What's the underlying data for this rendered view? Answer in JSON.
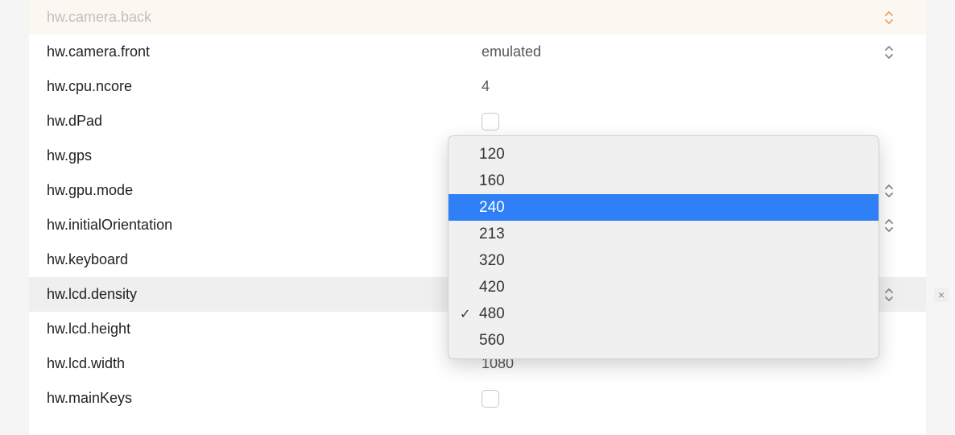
{
  "rows": [
    {
      "key": "hw.camera.back",
      "value": "",
      "type": "select",
      "faded": true,
      "stepperColor": "orange"
    },
    {
      "key": "hw.camera.front",
      "value": "emulated",
      "type": "select"
    },
    {
      "key": "hw.cpu.ncore",
      "value": "4",
      "type": "text"
    },
    {
      "key": "hw.dPad",
      "value": "",
      "type": "checkbox"
    },
    {
      "key": "hw.gps",
      "value": "",
      "type": "none"
    },
    {
      "key": "hw.gpu.mode",
      "value": "",
      "type": "select"
    },
    {
      "key": "hw.initialOrientation",
      "value": "",
      "type": "select"
    },
    {
      "key": "hw.keyboard",
      "value": "",
      "type": "none"
    },
    {
      "key": "hw.lcd.density",
      "value": "",
      "type": "select",
      "selected": true,
      "showClose": true
    },
    {
      "key": "hw.lcd.height",
      "value": "",
      "type": "none"
    },
    {
      "key": "hw.lcd.width",
      "value": "1080",
      "type": "text"
    },
    {
      "key": "hw.mainKeys",
      "value": "",
      "type": "checkbox"
    }
  ],
  "dropdown": {
    "options": [
      "120",
      "160",
      "240",
      "213",
      "320",
      "420",
      "480",
      "560"
    ],
    "highlighted": "240",
    "checked": "480"
  }
}
